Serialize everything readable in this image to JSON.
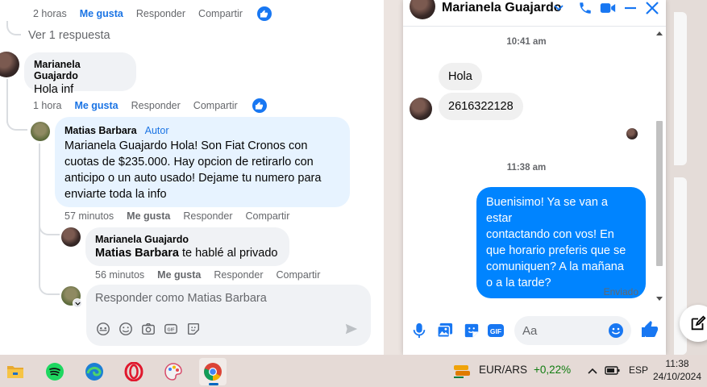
{
  "feed": {
    "top_actions": {
      "time": "2 horas",
      "like": "Me gusta",
      "reply": "Responder",
      "share": "Compartir"
    },
    "view_replies": "Ver 1 respuesta",
    "comment1": {
      "author": "Marianela Guajardo",
      "text": "Hola inf",
      "time": "1 hora",
      "like": "Me gusta",
      "reply": "Responder",
      "share": "Compartir"
    },
    "comment2": {
      "author": "Matias Barbara",
      "badge": "Autor",
      "lines": [
        "Marianela Guajardo Hola! Son Fiat Cronos con",
        "cuotas de $235.000. Hay opcion de retirarlo con",
        "anticipo o un auto usado! Dejame tu numero para",
        "enviarte toda la info"
      ],
      "time": "57 minutos",
      "like": "Me gusta",
      "reply": "Responder",
      "share": "Compartir"
    },
    "comment3": {
      "author": "Marianela Guajardo",
      "mention": "Matias Barbara",
      "text": " te hablé al privado",
      "time": "56 minutos",
      "like": "Me gusta",
      "reply": "Responder",
      "share": "Compartir"
    },
    "reply_placeholder": "Responder como Matias Barbara",
    "reply_icons": [
      "avatar-sticker-icon",
      "emoji-icon",
      "camera-icon",
      "gif-icon",
      "sticker-icon",
      "send-icon"
    ]
  },
  "chat": {
    "title": "Marianela Guajardo",
    "header_icons": [
      "chevron-down-icon",
      "phone-icon",
      "video-icon",
      "minimize-icon",
      "close-icon"
    ],
    "timestamps": [
      "10:41 am",
      "11:38 am"
    ],
    "incoming": [
      "Hola",
      "2616322128"
    ],
    "outgoing_lines": [
      "Buenisimo! Ya se van a estar",
      "contactando con vos! En",
      "que horario preferis que se",
      "comuniquen? A la mañana",
      "o a la tarde?"
    ],
    "status": "Enviado",
    "composer_placeholder": "Aa",
    "composer_icons": [
      "mic-icon",
      "image-icon",
      "sticker-icon",
      "gif-icon",
      "emoji-icon",
      "thumbs-up-icon"
    ],
    "accent": "#0084ff"
  },
  "taskbar": {
    "apps": [
      "file-explorer",
      "spotify",
      "edge",
      "opera",
      "paint",
      "chrome"
    ],
    "ticker_pair": "EUR/ARS",
    "ticker_change": "+0,22%",
    "language": "ESP",
    "time": "11:38",
    "date": "24/10/2024"
  }
}
